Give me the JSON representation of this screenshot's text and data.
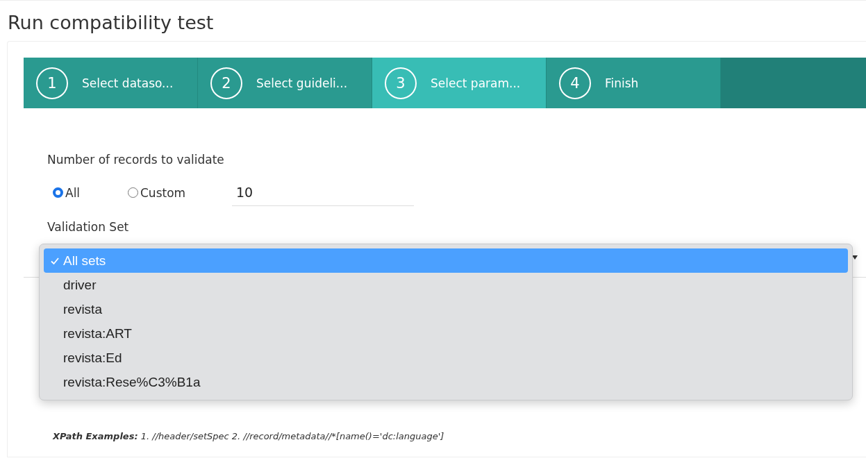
{
  "page": {
    "title": "Run compatibility test"
  },
  "steps": [
    {
      "number": "1",
      "label": "Select dataso...",
      "selected": false
    },
    {
      "number": "2",
      "label": "Select guideli...",
      "selected": false
    },
    {
      "number": "3",
      "label": "Select param...",
      "selected": true
    },
    {
      "number": "4",
      "label": "Finish",
      "selected": false
    }
  ],
  "records": {
    "label": "Number of records to validate",
    "options": [
      {
        "label": "All",
        "selected": true
      },
      {
        "label": "Custom",
        "selected": false
      }
    ],
    "value": "10"
  },
  "validation_set": {
    "label": "Validation Set",
    "options": [
      {
        "label": "All sets",
        "selected": true
      },
      {
        "label": "driver",
        "selected": false
      },
      {
        "label": "revista",
        "selected": false
      },
      {
        "label": "revista:ART",
        "selected": false
      },
      {
        "label": "revista:Ed",
        "selected": false
      },
      {
        "label": "revista:Rese%C3%B1a",
        "selected": false
      }
    ]
  },
  "xpath_examples": "**XPath Examples:** 1. //header/setSpec 2. //record/metadata//*[name()='dc:language']"
}
